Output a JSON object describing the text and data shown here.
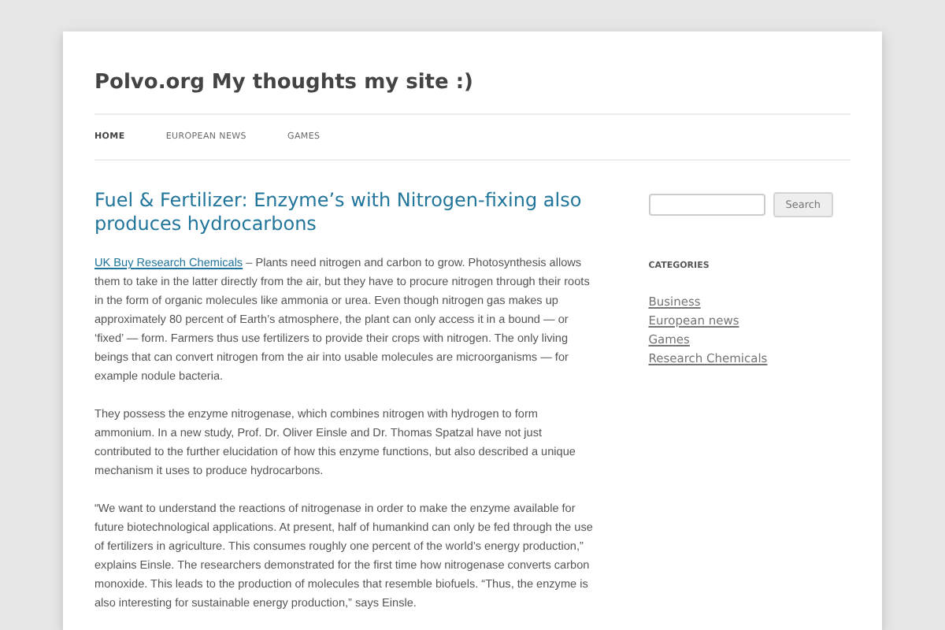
{
  "site_title": "Polvo.org My thoughts my site :)",
  "nav": [
    {
      "label": "HOME",
      "selected": true
    },
    {
      "label": "EUROPEAN NEWS",
      "selected": false
    },
    {
      "label": "GAMES",
      "selected": false
    }
  ],
  "post": {
    "title": "Fuel & Fertilizer: Enzyme’s with Nitrogen-fixing also produces hydrocarbons",
    "link": "UK Buy Research Chemicals",
    "paragraphs": [
      "– Plants need nitrogen and carbon to grow. Photosynthesis allows them to take in the latter directly from the air, but they have to procure nitrogen through their roots in the form of organic molecules like ammonia or urea. Even though nitrogen gas makes up approximately 80 percent of Earth’s atmosphere, the plant can only access it in a bound — or ‘fixed’ — form. Farmers thus use fertilizers to provide their crops with nitrogen. The only living beings that can convert nitrogen from the air into usable molecules are microorganisms — for example nodule bacteria.",
      "They possess the enzyme nitrogenase, which combines nitrogen with hydrogen to form ammonium. In a new study, Prof. Dr. Oliver Einsle and Dr. Thomas Spatzal have not just contributed to the further elucidation of how this enzyme functions, but also described a unique mechanism it uses to produce hydrocarbons.",
      "“We want to understand the reactions of nitrogenase in order to make the enzyme available for future biotechnological applications. At present, half of humankind can only be fed through the use of fertilizers in agriculture. This consumes roughly one percent of the world’s energy production,” explains Einsle. The researchers demonstrated for the first time how nitrogenase converts carbon monoxide. This leads to the production of molecules that resemble biofuels. “Thus, the enzyme is also interesting for sustainable energy production,” says Einsle."
    ]
  },
  "sidebar": {
    "search_button": "Search",
    "categories_heading": "CATEGORIES",
    "categories": [
      "Business",
      "European news",
      "Games",
      "Research Chemicals"
    ]
  }
}
